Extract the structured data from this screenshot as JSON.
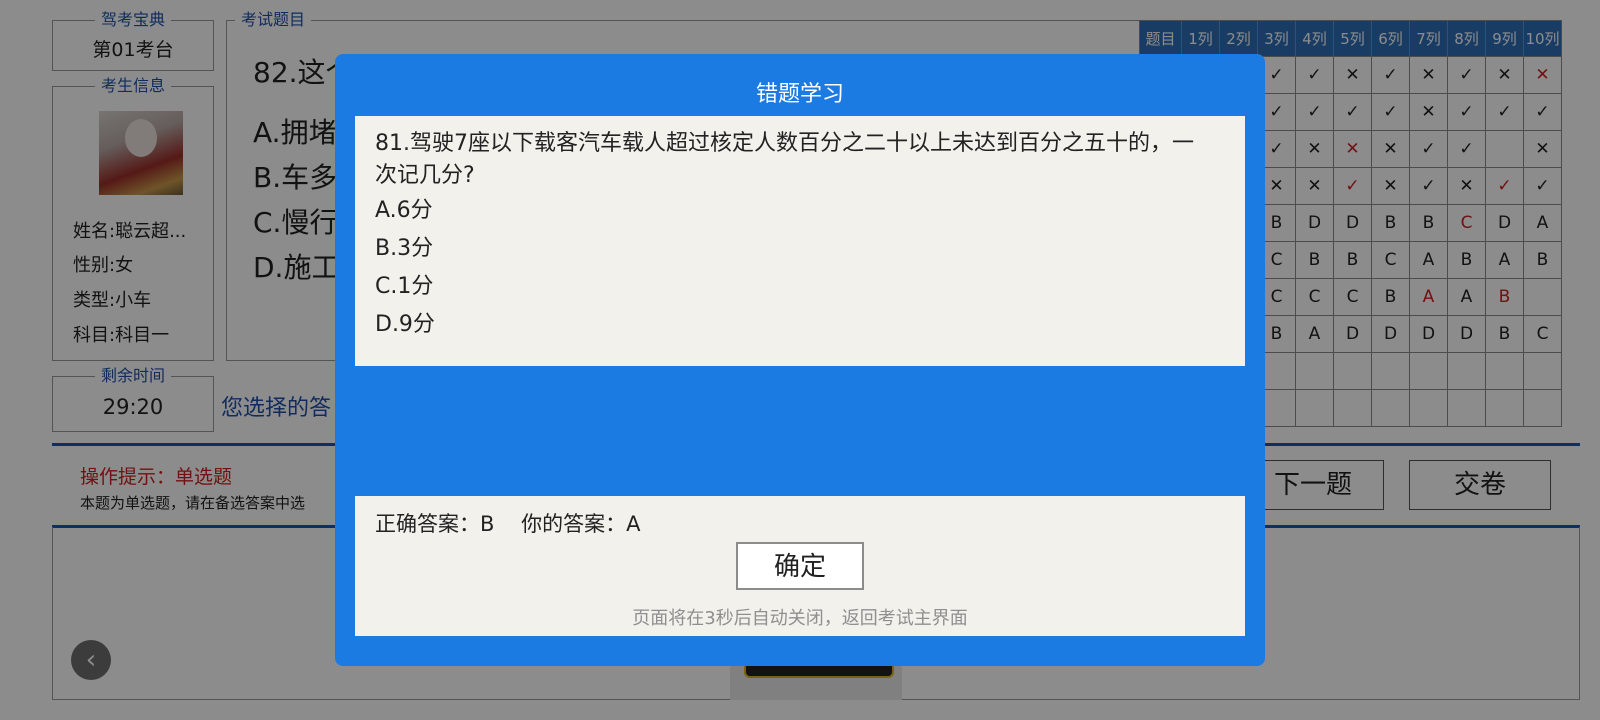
{
  "app": {
    "brand": "驾考宝典",
    "station": "第01考台",
    "candidate_legend": "考生信息",
    "name": "姓名:聪云超...",
    "gender": "性别:女",
    "type": "类型:小车",
    "subject": "科目:科目一",
    "time_legend": "剩余时间",
    "time_left": "29:20"
  },
  "question_box": {
    "legend": "考试题目",
    "question": "82.这个",
    "options": [
      "A.拥堵",
      "B.车多",
      "C.慢行",
      "D.施工"
    ],
    "your_choice": "您选择的答"
  },
  "grid": {
    "headers": [
      "题目",
      "1列",
      "2列",
      "3列",
      "4列",
      "5列",
      "6列",
      "7列",
      "8列",
      "9列",
      "10列"
    ],
    "rows": [
      [
        "",
        "",
        "",
        "✓",
        "✓",
        "✕",
        "✓",
        "✕",
        "✓",
        "✕",
        "✕"
      ],
      [
        "",
        "",
        "",
        "✓",
        "✓",
        "✓",
        "✓",
        "✕",
        "✓",
        "✓",
        "✓"
      ],
      [
        "",
        "",
        "",
        "✓",
        "✕",
        "✕",
        "✕",
        "✓",
        "✓",
        "",
        "✕"
      ],
      [
        "",
        "",
        "",
        "✕",
        "✕",
        "✓",
        "✕",
        "✓",
        "✕",
        "✓",
        "✓"
      ],
      [
        "",
        "",
        "",
        "B",
        "D",
        "D",
        "B",
        "B",
        "C",
        "D",
        "A"
      ],
      [
        "",
        "",
        "",
        "C",
        "B",
        "B",
        "C",
        "A",
        "B",
        "A",
        "B"
      ],
      [
        "",
        "",
        "",
        "C",
        "C",
        "C",
        "B",
        "A",
        "A",
        "B",
        ""
      ],
      [
        "",
        "",
        "",
        "B",
        "A",
        "D",
        "D",
        "D",
        "D",
        "B",
        "C"
      ],
      [
        "",
        "",
        "",
        "",
        "",
        "",
        "",
        "",
        "",
        "",
        ""
      ],
      [
        "",
        "",
        "",
        "",
        "",
        "",
        "",
        "",
        "",
        "",
        ""
      ]
    ],
    "red_cells": [
      "0-10",
      "2-5",
      "3-5",
      "3-9",
      "4-8",
      "6-7",
      "6-9"
    ]
  },
  "hint": {
    "title": "操作提示：单选题",
    "body": "本题为单选题，请在备选答案中选"
  },
  "buttons": {
    "next": "下一题",
    "submit": "交卷",
    "back_icon": "chevron-left-icon"
  },
  "modal": {
    "title": "错题学习",
    "question": "81.驾驶7座以下载客汽车载人超过核定人数百分之二十以上未达到百分之五十的，一次记几分?",
    "options": [
      "A.6分",
      "B.3分",
      "C.1分",
      "D.9分"
    ],
    "answer_line": "正确答案：B    你的答案：A",
    "ok_label": "确定",
    "note": "页面将在3秒后自动关闭，返回考试主界面"
  },
  "colors": {
    "modal_blue": "#1c7be3",
    "grid_header_blue": "#2f6db7",
    "error_red": "#d01f1f",
    "legend_blue": "#1f4fa8"
  }
}
